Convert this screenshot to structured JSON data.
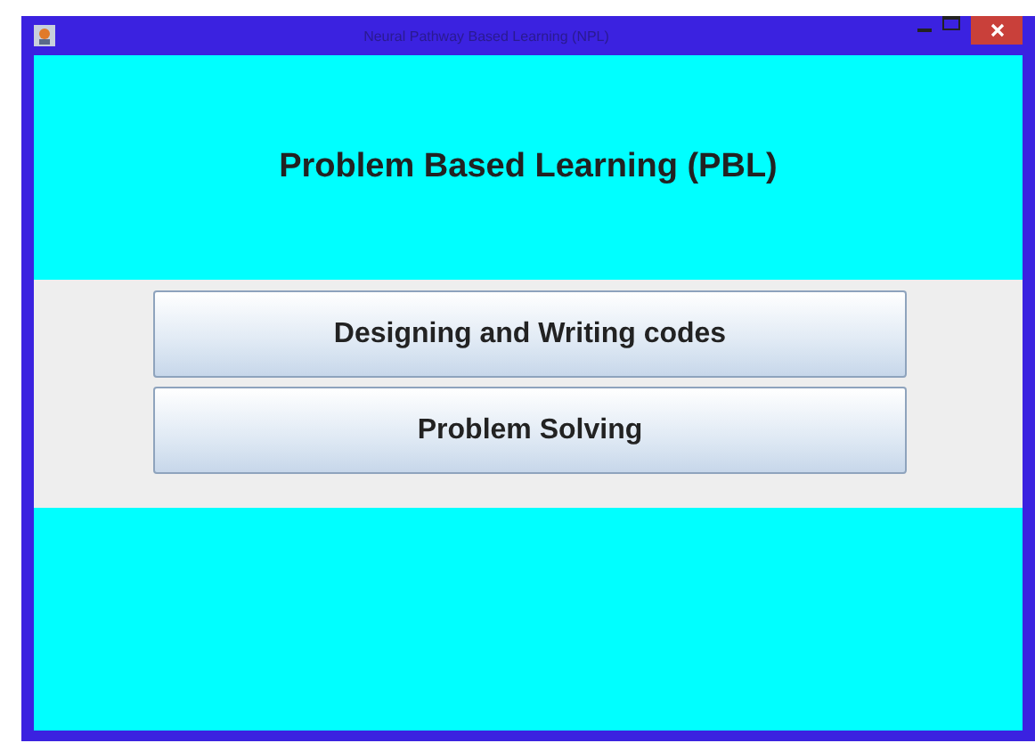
{
  "window": {
    "title": "Neural Pathway Based Learning (NPL)"
  },
  "heading": "Problem Based Learning (PBL)",
  "buttons": [
    "Designing and Writing codes",
    "Problem Solving"
  ]
}
